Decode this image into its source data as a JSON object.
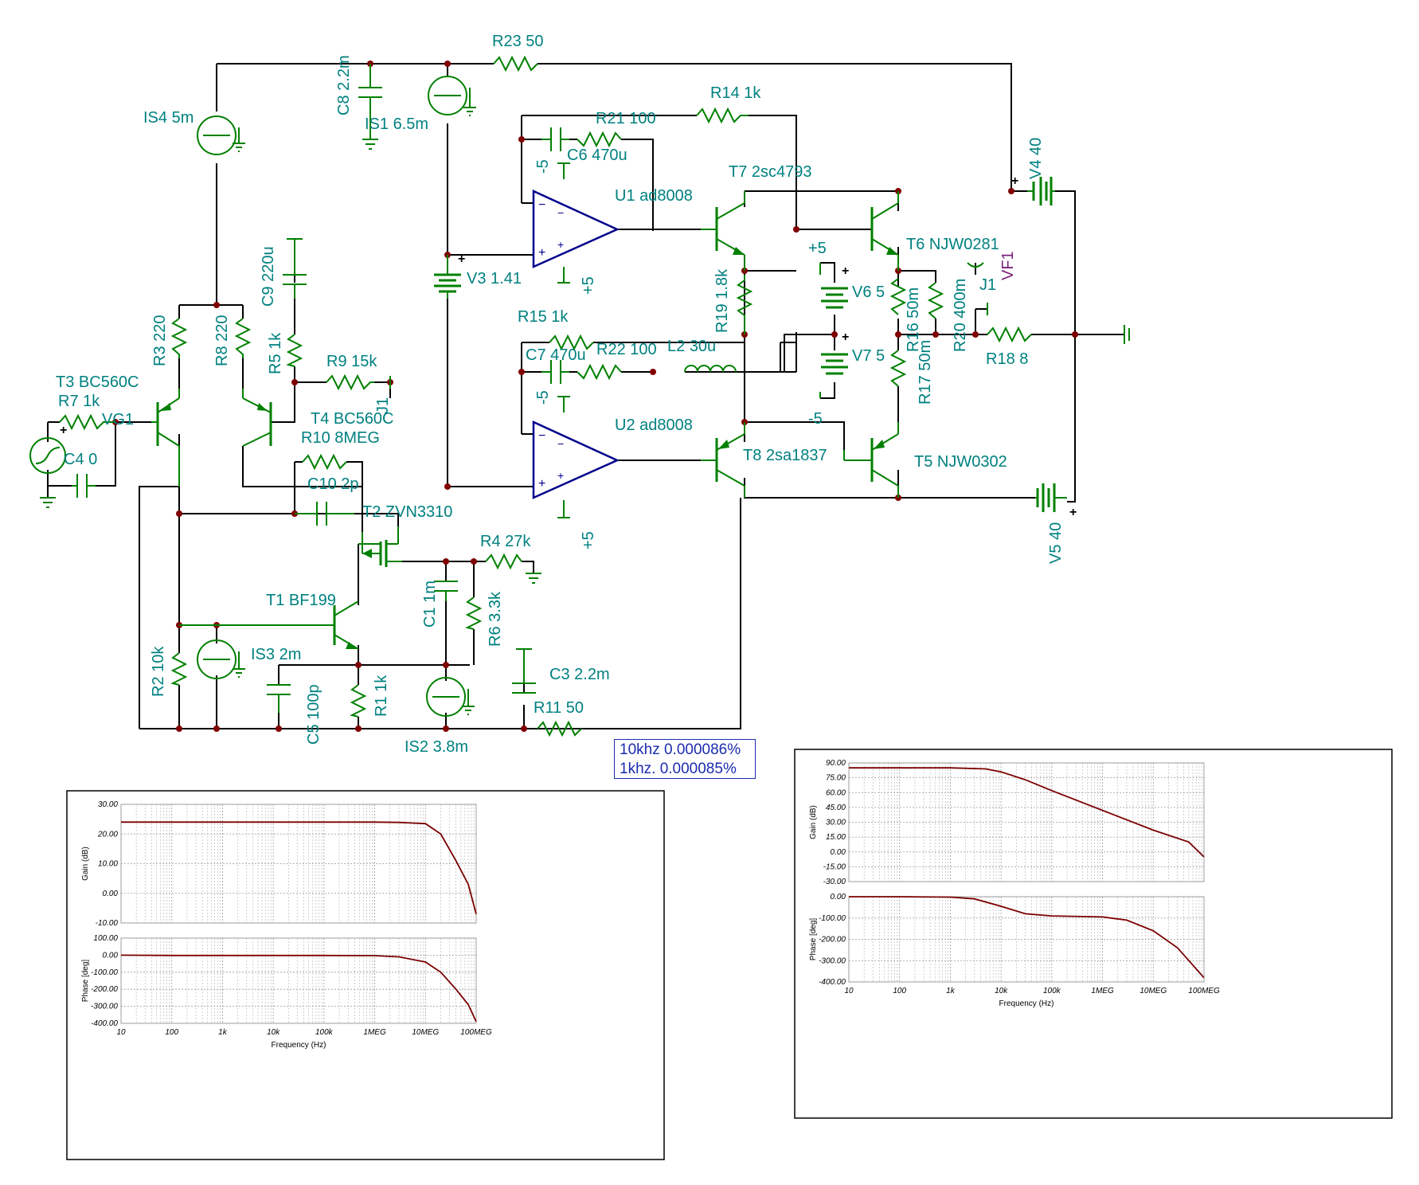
{
  "schematic": {
    "components": [
      {
        "ref": "R23",
        "value": "50"
      },
      {
        "ref": "C8",
        "value": "2.2m"
      },
      {
        "ref": "IS1",
        "value": "6.5m"
      },
      {
        "ref": "IS4",
        "value": "5m"
      },
      {
        "ref": "R14",
        "value": "1k"
      },
      {
        "ref": "R21",
        "value": "100"
      },
      {
        "ref": "C6",
        "value": "470u"
      },
      {
        "ref": "U1",
        "value": "ad8008"
      },
      {
        "ref": "T7",
        "value": "2sc4793"
      },
      {
        "ref": "V4",
        "value": "40"
      },
      {
        "ref": "T6",
        "value": "NJW0281"
      },
      {
        "ref": "C9",
        "value": "220u"
      },
      {
        "ref": "V3",
        "value": "1.41"
      },
      {
        "ref": "V6",
        "value": "5"
      },
      {
        "ref": "R19",
        "value": "1.8k"
      },
      {
        "ref": "R16",
        "value": "50m"
      },
      {
        "ref": "R20",
        "value": "400m"
      },
      {
        "ref": "R3",
        "value": "220"
      },
      {
        "ref": "R8",
        "value": "220"
      },
      {
        "ref": "R5",
        "value": "1k"
      },
      {
        "ref": "R15",
        "value": "1k"
      },
      {
        "ref": "R9",
        "value": "15k"
      },
      {
        "ref": "C7",
        "value": "470u"
      },
      {
        "ref": "R22",
        "value": "100"
      },
      {
        "ref": "L2",
        "value": "30u"
      },
      {
        "ref": "V7",
        "value": "5"
      },
      {
        "ref": "R18",
        "value": "8"
      },
      {
        "ref": "R17",
        "value": "50m"
      },
      {
        "ref": "T3",
        "value": "BC560C"
      },
      {
        "ref": "R7",
        "value": "1k"
      },
      {
        "ref": "T4",
        "value": "BC560C"
      },
      {
        "ref": "U2",
        "value": "ad8008"
      },
      {
        "ref": "C4",
        "value": "0"
      },
      {
        "ref": "R10",
        "value": "8MEG"
      },
      {
        "ref": "T8",
        "value": "2sa1837"
      },
      {
        "ref": "T5",
        "value": "NJW0302"
      },
      {
        "ref": "C10",
        "value": "2p"
      },
      {
        "ref": "T2",
        "value": "ZVN3310"
      },
      {
        "ref": "V5",
        "value": "40"
      },
      {
        "ref": "R4",
        "value": "27k"
      },
      {
        "ref": "C1",
        "value": "1m"
      },
      {
        "ref": "T1",
        "value": "BF199"
      },
      {
        "ref": "R6",
        "value": "3.3k"
      },
      {
        "ref": "R2",
        "value": "10k"
      },
      {
        "ref": "IS3",
        "value": "2m"
      },
      {
        "ref": "C3",
        "value": "2.2m"
      },
      {
        "ref": "C5",
        "value": "100p"
      },
      {
        "ref": "R1",
        "value": "1k"
      },
      {
        "ref": "R11",
        "value": "50"
      },
      {
        "ref": "IS2",
        "value": "3.8m"
      }
    ],
    "nodes": {
      "vg1": "VG1",
      "j1a": "J1",
      "j1b": "J1",
      "vf1": "VF1"
    },
    "supply": {
      "p5": "+5",
      "m5": "-5",
      "plus": "+"
    }
  },
  "thd": {
    "line1": "10khz 0.000086%",
    "line2": "1khz.  0.000085%"
  },
  "plots": [
    {
      "gain": {
        "ylabel": "Gain (dB)",
        "ylim": [
          -10,
          30
        ],
        "ticks": [
          "30.00",
          "20.00",
          "10.00",
          "0.00",
          "-10.00"
        ]
      },
      "phase": {
        "ylabel": "Phase [deg]",
        "ylim": [
          -400,
          100
        ],
        "ticks": [
          "100.00",
          "0.00",
          "-100.00",
          "-200.00",
          "-300.00",
          "-400.00"
        ]
      },
      "xlabel": "Frequency (Hz)",
      "xticks": [
        "10",
        "100",
        "1k",
        "10k",
        "100k",
        "1MEG",
        "10MEG",
        "100MEG"
      ]
    },
    {
      "gain": {
        "ylabel": "Gain (dB)",
        "ylim": [
          -30,
          90
        ],
        "ticks": [
          "90.00",
          "75.00",
          "60.00",
          "45.00",
          "30.00",
          "15.00",
          "0.00",
          "-15.00",
          "-30.00"
        ]
      },
      "phase": {
        "ylabel": "Phase [deg]",
        "ylim": [
          -400,
          0
        ],
        "ticks": [
          "0.00",
          "-100.00",
          "-200.00",
          "-300.00",
          "-400.00"
        ]
      },
      "xlabel": "Frequency (Hz)",
      "xticks": [
        "10",
        "100",
        "1k",
        "10k",
        "100k",
        "1MEG",
        "10MEG",
        "100MEG"
      ]
    }
  ],
  "chart_data": [
    {
      "type": "line",
      "title": "",
      "xlabel": "Frequency (Hz)",
      "ylabel": "Gain (dB)",
      "xscale": "log",
      "xlim": [
        10,
        100000000
      ],
      "ylim": [
        -10,
        30
      ],
      "series": [
        {
          "x": [
            10,
            100,
            1000,
            10000,
            100000,
            1000000,
            3000000,
            10000000,
            20000000,
            40000000,
            70000000,
            100000000
          ],
          "y": [
            24,
            24,
            24,
            24,
            24,
            24,
            23.9,
            23.5,
            20,
            11,
            3,
            -7
          ]
        }
      ]
    },
    {
      "type": "line",
      "title": "",
      "xlabel": "Frequency (Hz)",
      "ylabel": "Phase [deg]",
      "xscale": "log",
      "xlim": [
        10,
        100000000
      ],
      "ylim": [
        -400,
        100
      ],
      "series": [
        {
          "x": [
            10,
            100,
            1000,
            10000,
            100000,
            1000000,
            3000000,
            10000000,
            20000000,
            40000000,
            70000000,
            100000000
          ],
          "y": [
            0,
            -2,
            -2,
            -2,
            -2,
            -3,
            -10,
            -40,
            -100,
            -200,
            -290,
            -390
          ]
        }
      ]
    },
    {
      "type": "line",
      "title": "",
      "xlabel": "Frequency (Hz)",
      "ylabel": "Gain (dB)",
      "xscale": "log",
      "xlim": [
        10,
        100000000
      ],
      "ylim": [
        -30,
        90
      ],
      "series": [
        {
          "x": [
            10,
            100,
            1000,
            5000,
            10000,
            30000,
            100000,
            1000000,
            10000000,
            50000000,
            100000000
          ],
          "y": [
            85,
            85,
            85,
            84,
            81,
            73,
            62,
            42,
            22,
            10,
            -5
          ]
        }
      ]
    },
    {
      "type": "line",
      "title": "",
      "xlabel": "Frequency (Hz)",
      "ylabel": "Phase [deg]",
      "xscale": "log",
      "xlim": [
        10,
        100000000
      ],
      "ylim": [
        -400,
        0
      ],
      "series": [
        {
          "x": [
            10,
            100,
            1000,
            3000,
            10000,
            30000,
            100000,
            1000000,
            3000000,
            10000000,
            30000000,
            100000000
          ],
          "y": [
            0,
            0,
            -2,
            -10,
            -45,
            -80,
            -90,
            -95,
            -110,
            -160,
            -240,
            -380
          ]
        }
      ]
    }
  ]
}
